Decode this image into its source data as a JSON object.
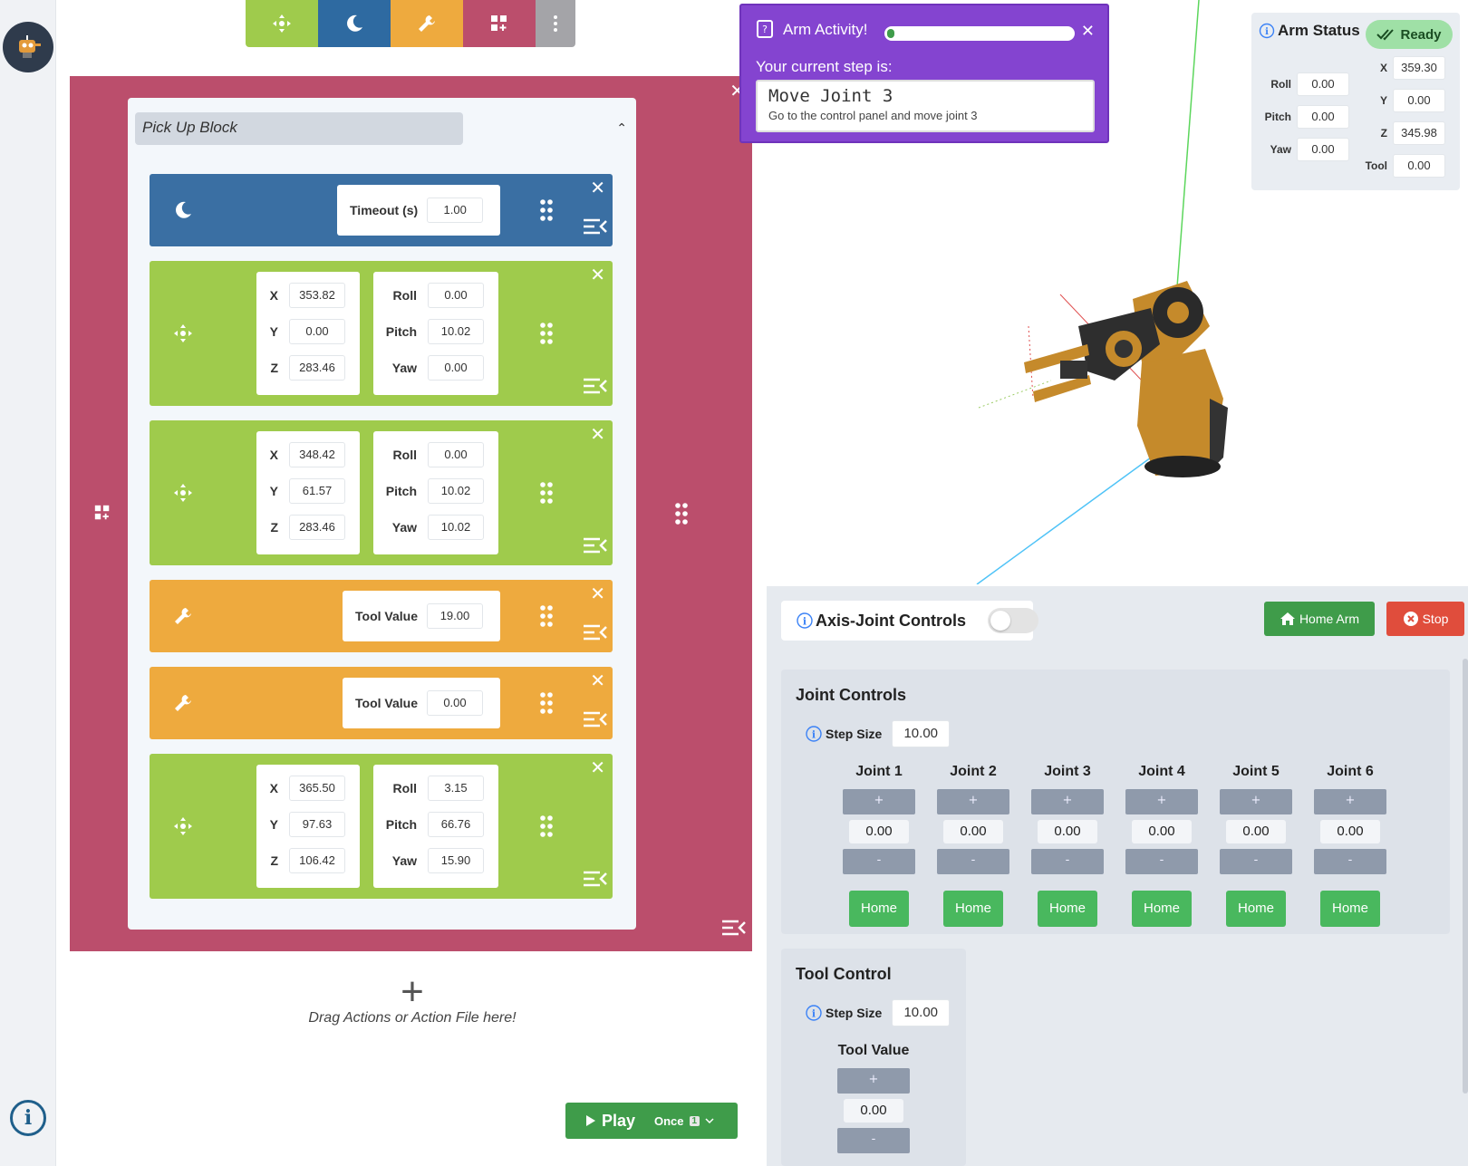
{
  "toolbar": {
    "colors": [
      "#9fcb4c",
      "#2e6aa1",
      "#eeaa3e",
      "#bb4e6c",
      "#a4a4a8"
    ],
    "icons": [
      "move-icon",
      "sleep-icon",
      "tool-icon",
      "add-block-icon",
      "more-icon"
    ]
  },
  "program": {
    "title": "Pick Up Block",
    "actions": [
      {
        "type": "sleep",
        "timeout_label": "Timeout (s)",
        "timeout": "1.00"
      },
      {
        "type": "move",
        "x": "353.82",
        "y": "0.00",
        "z": "283.46",
        "roll": "0.00",
        "pitch": "10.02",
        "yaw": "0.00"
      },
      {
        "type": "move",
        "x": "348.42",
        "y": "61.57",
        "z": "283.46",
        "roll": "0.00",
        "pitch": "10.02",
        "yaw": "10.02"
      },
      {
        "type": "tool",
        "tool_label": "Tool Value",
        "tool": "19.00"
      },
      {
        "type": "tool",
        "tool_label": "Tool Value",
        "tool": "0.00"
      },
      {
        "type": "move",
        "x": "365.50",
        "y": "97.63",
        "z": "106.42",
        "roll": "3.15",
        "pitch": "66.76",
        "yaw": "15.90"
      }
    ],
    "labels": {
      "x": "X",
      "y": "Y",
      "z": "Z",
      "roll": "Roll",
      "pitch": "Pitch",
      "yaw": "Yaw"
    },
    "drop_hint": "Drag Actions or Action File here!",
    "drop_plus": "+"
  },
  "playbar": {
    "play_label": "Play",
    "mode": "Once",
    "count": "1"
  },
  "activity": {
    "title": "Arm Activity!",
    "progress": 0.03,
    "current_step_label": "Your current step is:",
    "step_title": "Move Joint 3",
    "step_desc": "Go to the control panel and move joint 3"
  },
  "arm_status": {
    "title": "Arm Status",
    "state": "Ready",
    "roll": "0.00",
    "pitch": "0.00",
    "yaw": "0.00",
    "x": "359.30",
    "y": "0.00",
    "z": "345.98",
    "tool": "0.00",
    "labels": {
      "roll": "Roll",
      "pitch": "Pitch",
      "yaw": "Yaw",
      "x": "X",
      "y": "Y",
      "z": "Z",
      "tool": "Tool"
    }
  },
  "controls": {
    "mode_label": "Axis-Joint Controls",
    "home_arm_label": "Home Arm",
    "stop_label": "Stop",
    "joint_title": "Joint Controls",
    "step_size_label": "Step Size",
    "joint_step": "10.00",
    "plus": "+",
    "minus": "-",
    "home": "Home",
    "joints": [
      {
        "name": "Joint 1",
        "value": "0.00"
      },
      {
        "name": "Joint 2",
        "value": "0.00"
      },
      {
        "name": "Joint 3",
        "value": "0.00"
      },
      {
        "name": "Joint 4",
        "value": "0.00"
      },
      {
        "name": "Joint 5",
        "value": "0.00"
      },
      {
        "name": "Joint 6",
        "value": "0.00"
      }
    ],
    "tool_title": "Tool Control",
    "tool_step": "10.00",
    "tool_value_label": "Tool Value",
    "tool_value": "0.00"
  }
}
